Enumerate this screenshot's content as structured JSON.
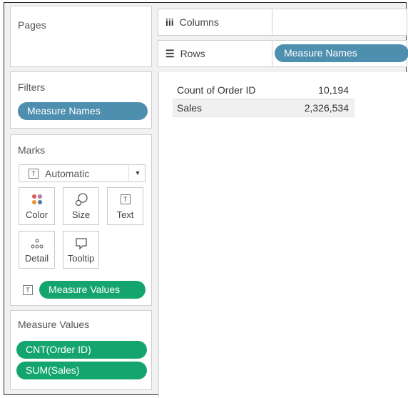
{
  "left": {
    "pages": {
      "title": "Pages"
    },
    "filters": {
      "title": "Filters",
      "pill": "Measure Names"
    },
    "marks": {
      "title": "Marks",
      "type_select": "Automatic",
      "buttons": {
        "color": "Color",
        "size": "Size",
        "text": "Text",
        "detail": "Detail",
        "tooltip": "Tooltip"
      },
      "text_icon": "T",
      "pill": "Measure Values"
    },
    "measure_values": {
      "title": "Measure Values",
      "pills": [
        "CNT(Order ID)",
        "SUM(Sales)"
      ]
    }
  },
  "shelves": {
    "columns": {
      "icon": "iii",
      "label": "Columns"
    },
    "rows": {
      "icon": "☰",
      "label": "Rows",
      "pill": "Measure Names"
    }
  },
  "table": {
    "rows": [
      {
        "label": "Count of Order ID",
        "value": "10,194"
      },
      {
        "label": "Sales",
        "value": "2,326,534"
      }
    ]
  },
  "colors": {
    "dimension_pill": "#4e8fb0",
    "measure_pill": "#14a56e",
    "row_stripe": "#f0f0f0"
  }
}
